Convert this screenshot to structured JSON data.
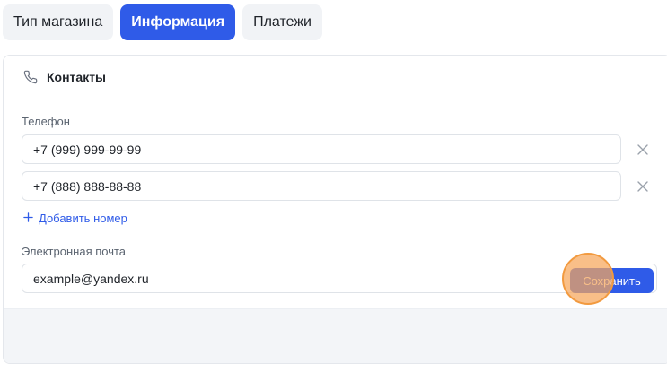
{
  "tabs": [
    {
      "label": "Тип магазина",
      "active": false
    },
    {
      "label": "Информация",
      "active": true
    },
    {
      "label": "Платежи",
      "active": false
    }
  ],
  "section": {
    "icon": "phone-icon",
    "title": "Контакты"
  },
  "phone": {
    "label": "Телефон",
    "numbers": [
      "+7 (999) 999-99-99",
      "+7 (888) 888-88-88"
    ],
    "add_label": "Добавить номер"
  },
  "email": {
    "label": "Электронная почта",
    "value": "example@yandex.ru"
  },
  "footer": {
    "save_label": "Сохранить"
  },
  "colors": {
    "accent": "#2f5be8",
    "tab_bg": "#f1f3f6",
    "footer_bg": "#f3f5f8",
    "cursor_highlight": "#f6a65a"
  }
}
